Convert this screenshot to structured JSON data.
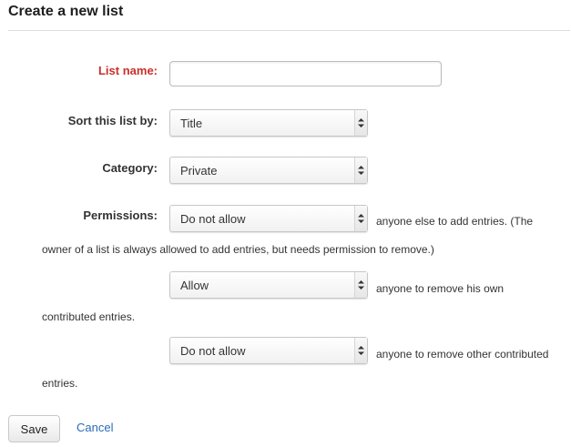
{
  "page": {
    "title": "Create a new list"
  },
  "form": {
    "list_name": {
      "label": "List name:",
      "value": "",
      "placeholder": ""
    },
    "sort": {
      "label": "Sort this list by:",
      "selected": "Title"
    },
    "category": {
      "label": "Category:",
      "selected": "Private"
    },
    "permissions": {
      "label": "Permissions:",
      "add_entries": {
        "selected": "Do not allow",
        "text_line1": "anyone else to add entries. (The",
        "text_line2": "owner of a list is always allowed to add entries, but needs permission to remove.)"
      },
      "remove_own": {
        "selected": "Allow",
        "text_line1": "anyone to remove his own",
        "text_line2": "contributed entries."
      },
      "remove_other": {
        "selected": "Do not allow",
        "text_line1": "anyone to remove other contributed",
        "text_line2": "entries."
      }
    }
  },
  "actions": {
    "save_label": "Save",
    "cancel_label": "Cancel"
  },
  "icons": {
    "select_arrow": "select-arrow-icon"
  },
  "colors": {
    "required_label": "#c9302c",
    "link": "#2a6db8",
    "divider": "#dddddd"
  }
}
